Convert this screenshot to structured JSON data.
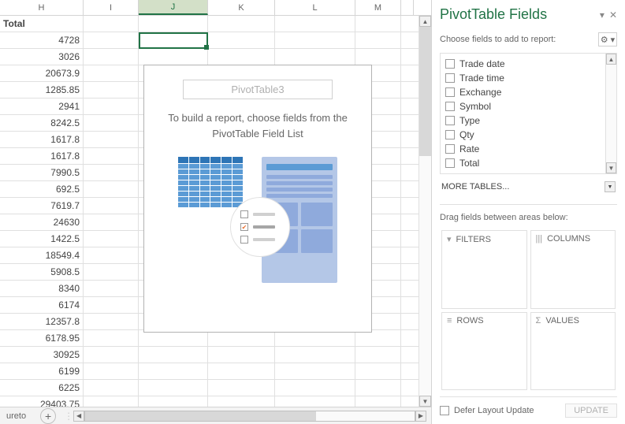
{
  "columns": [
    "H",
    "I",
    "J",
    "K",
    "L",
    "M"
  ],
  "active_col": "J",
  "total_header": "Total",
  "values": [
    4728,
    3026,
    20673.9,
    1285.85,
    2941,
    8242.5,
    1617.8,
    1617.8,
    7990.5,
    692.5,
    7619.7,
    24630,
    1422.5,
    18549.4,
    5908.5,
    8340,
    6174,
    12357.8,
    6178.95,
    30925,
    6199,
    6225,
    29403.75
  ],
  "pivot": {
    "title": "PivotTable3",
    "msg1": "To build a report, choose fields from the",
    "msg2": "PivotTable Field List"
  },
  "tab": "ureto",
  "pane": {
    "title": "PivotTable Fields",
    "subtitle": "Choose fields to add to report:",
    "fields": [
      "Trade date",
      "Trade time",
      "Exchange",
      "Symbol",
      "Type",
      "Qty",
      "Rate",
      "Total"
    ],
    "more": "MORE TABLES...",
    "drag": "Drag fields between areas below:",
    "areas": {
      "filters": "FILTERS",
      "columns": "COLUMNS",
      "rows": "ROWS",
      "values": "VALUES"
    },
    "defer": "Defer Layout Update",
    "update": "UPDATE"
  }
}
